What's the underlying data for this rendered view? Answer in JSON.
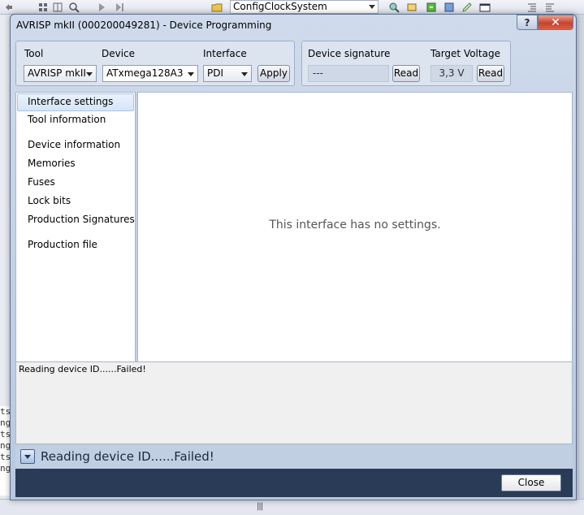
{
  "background": {
    "toolbar_combo_value": "ConfigClockSystem",
    "output_lines": [
      "ts",
      "ng",
      "ts",
      "ng",
      "ts",
      "ng"
    ]
  },
  "window": {
    "title": "AVRISP mkII (000200049281) - Device Programming",
    "help_glyph": "?",
    "close_glyph": "✕"
  },
  "controls": {
    "tool_label": "Tool",
    "tool_value": "AVRISP mkII",
    "device_label": "Device",
    "device_value": "ATxmega128A3",
    "interface_label": "Interface",
    "interface_value": "PDI",
    "apply_label": "Apply",
    "signature_label": "Device signature",
    "signature_value": "---",
    "signature_read_label": "Read",
    "voltage_label": "Target Voltage",
    "voltage_value": "3,3 V",
    "voltage_read_label": "Read"
  },
  "nav": {
    "items": [
      {
        "label": "Interface settings",
        "active": true
      },
      {
        "label": "Tool information"
      },
      {
        "label": "Device information"
      },
      {
        "label": "Memories"
      },
      {
        "label": "Fuses"
      },
      {
        "label": "Lock bits"
      },
      {
        "label": "Production Signatures"
      },
      {
        "label": "Production file"
      }
    ]
  },
  "content": {
    "message": "This interface has no settings."
  },
  "log": {
    "text": "Reading device ID......Failed!"
  },
  "status": {
    "text": "Reading device ID......Failed!"
  },
  "footer": {
    "close_label": "Close"
  }
}
